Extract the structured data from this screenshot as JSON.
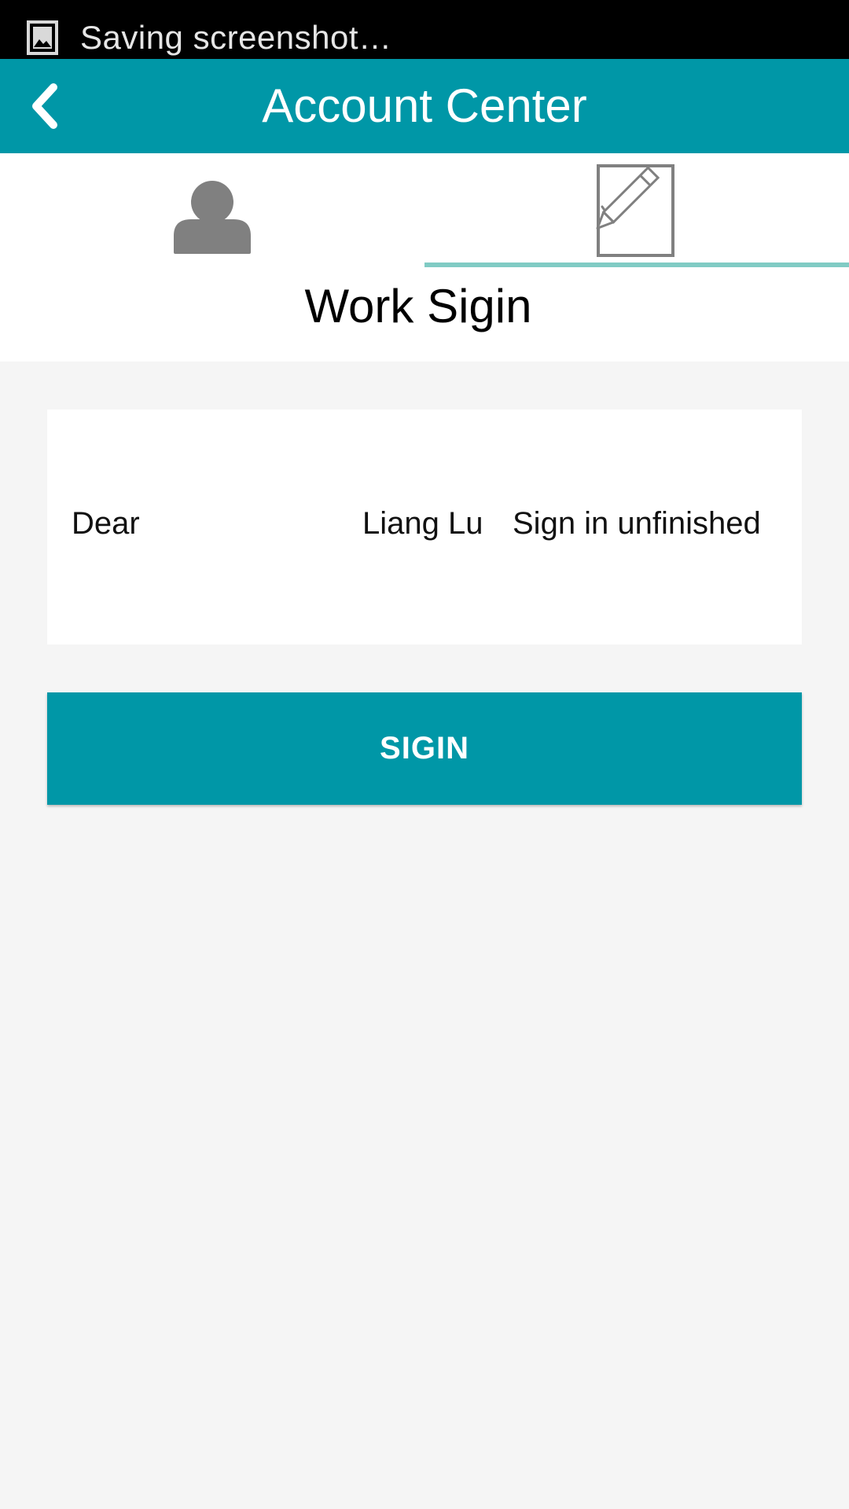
{
  "status_bar": {
    "icon": "image-icon",
    "text": "Saving screenshot…"
  },
  "app_bar": {
    "back_icon": "chevron-left-icon",
    "title": "Account Center"
  },
  "tabs": [
    {
      "icon": "user-icon",
      "selected": false
    },
    {
      "icon": "sign-checklist-icon",
      "selected": true
    }
  ],
  "section": {
    "title": "Work Sigin"
  },
  "card": {
    "greeting": "Dear",
    "username": "Liang Lu",
    "status": "Sign in unfinished"
  },
  "actions": {
    "sign_label": "SIGIN"
  },
  "colors": {
    "primary": "#0097a7",
    "tab_indicator": "#80cbc4",
    "background": "#f5f5f5",
    "icon_gray": "#808080"
  }
}
